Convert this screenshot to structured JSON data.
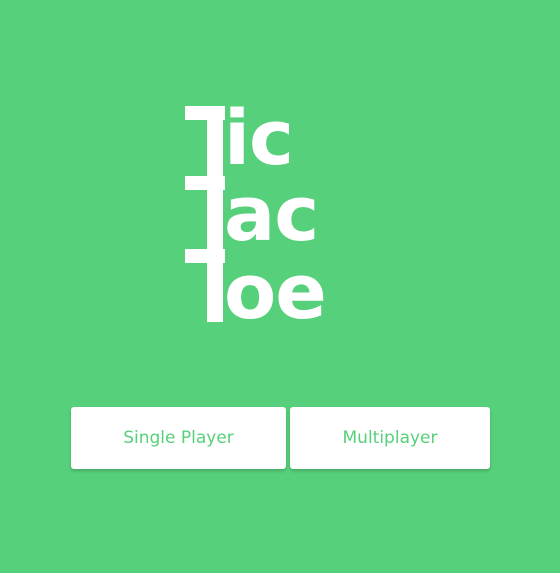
{
  "logo": {
    "line1": "ic",
    "line2": "ac",
    "line3": "oe"
  },
  "menu": {
    "single_player_label": "Single Player",
    "multiplayer_label": "Multiplayer"
  },
  "colors": {
    "background": "#56d07a",
    "button_background": "#ffffff",
    "button_text": "#56d07a"
  }
}
